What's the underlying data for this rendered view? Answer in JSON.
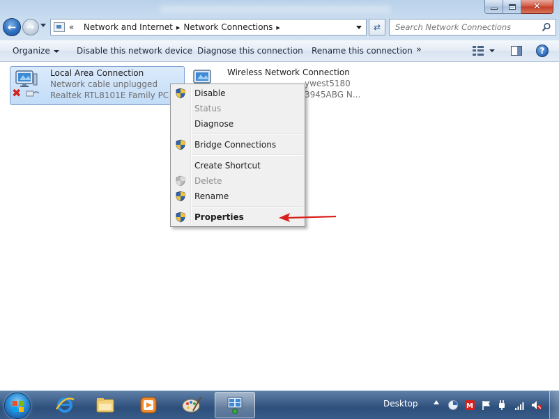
{
  "window": {
    "controls": {
      "minimize": "minimize",
      "maximize": "maximize",
      "close": "close"
    }
  },
  "address": {
    "prefix": "«",
    "crumbs": [
      "Network and Internet",
      "Network Connections"
    ],
    "search_placeholder": "Search Network Connections"
  },
  "commandbar": {
    "organize": "Organize",
    "disable": "Disable this network device",
    "diagnose": "Diagnose this connection",
    "rename": "Rename this connection",
    "more": "»"
  },
  "connections": [
    {
      "name": "Local Area Connection",
      "status": "Network cable unplugged",
      "device": "Realtek RTL8101E Family PCI-E F",
      "selected": true,
      "disconnected": true
    },
    {
      "name": "Wireless Network Connection",
      "status": "ywest5180",
      "device": "3945ABG N..."
    }
  ],
  "context_menu": {
    "items": [
      {
        "label": "Disable",
        "shield": true,
        "disabled": false,
        "bold": false
      },
      {
        "label": "Status",
        "shield": false,
        "disabled": true,
        "bold": false
      },
      {
        "label": "Diagnose",
        "shield": false,
        "disabled": false,
        "bold": false
      },
      {
        "label": "Bridge Connections",
        "shield": true,
        "disabled": false,
        "bold": false
      },
      {
        "label": "Create Shortcut",
        "shield": false,
        "disabled": false,
        "bold": false
      },
      {
        "label": "Delete",
        "shield": true,
        "disabled": true,
        "bold": false
      },
      {
        "label": "Rename",
        "shield": true,
        "disabled": false,
        "bold": false
      },
      {
        "label": "Properties",
        "shield": true,
        "disabled": false,
        "bold": true
      }
    ]
  },
  "annotation": {
    "color": "#d9201c"
  },
  "taskbar": {
    "desktop_label": "Desktop",
    "apps": [
      "internet-explorer",
      "windows-explorer",
      "media-player",
      "paint",
      "network-connections"
    ],
    "active_app": "network-connections"
  },
  "colors": {
    "selection_bg": "#c8dff8",
    "accent": "#2b6cbf",
    "disabled_text": "#8e8e8e"
  }
}
